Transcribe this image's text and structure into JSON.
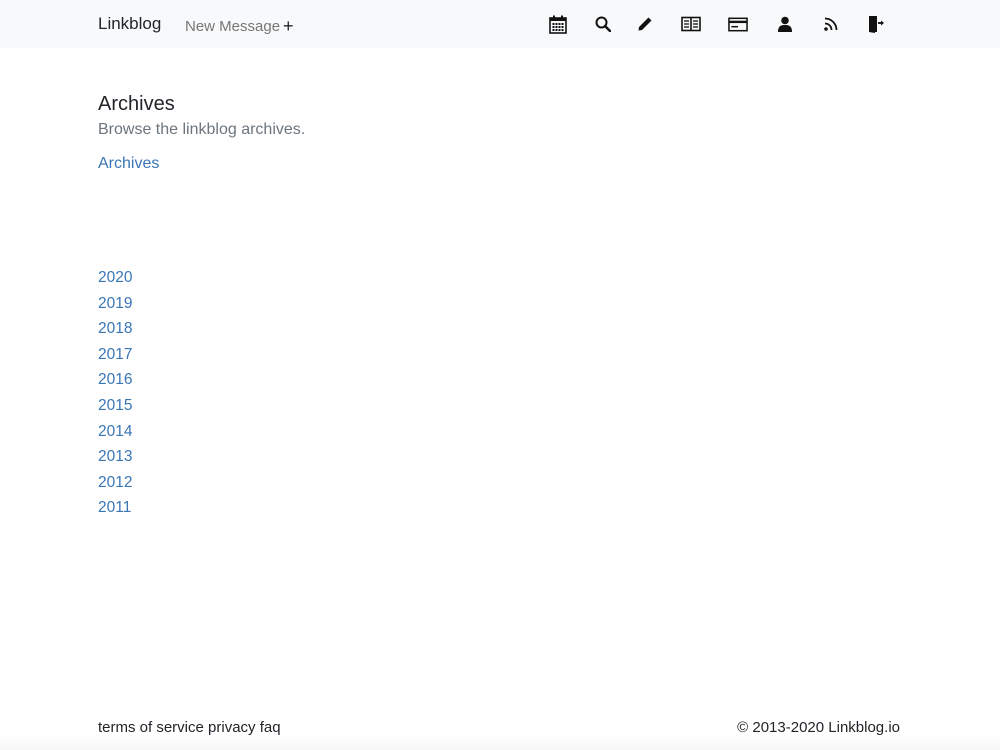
{
  "navbar": {
    "brand": "Linkblog",
    "new_message": "New Message",
    "new_message_icon": "+",
    "icons": [
      {
        "name": "calendar-icon",
        "label": "Calendar"
      },
      {
        "name": "search-icon",
        "label": "Search"
      },
      {
        "name": "pencil-icon",
        "label": "Edit"
      },
      {
        "name": "book-icon",
        "label": "Read"
      },
      {
        "name": "credit-card-icon",
        "label": "Billing"
      },
      {
        "name": "user-icon",
        "label": "Profile"
      },
      {
        "name": "rss-icon",
        "label": "RSS"
      },
      {
        "name": "logout-icon",
        "label": "Log out"
      }
    ]
  },
  "page": {
    "title": "Archives",
    "subtitle": "Browse the linkblog archives.",
    "archives_link": "Archives",
    "years": [
      "2020",
      "2019",
      "2018",
      "2017",
      "2016",
      "2015",
      "2014",
      "2013",
      "2012",
      "2011"
    ]
  },
  "footer": {
    "links": [
      "terms of service",
      "privacy",
      "faq"
    ],
    "copyright": "© 2013-2020 Linkblog.io"
  },
  "colors": {
    "link": "#3a76b5",
    "navbar_bg": "#f8f9fa",
    "muted": "#6c757d"
  }
}
